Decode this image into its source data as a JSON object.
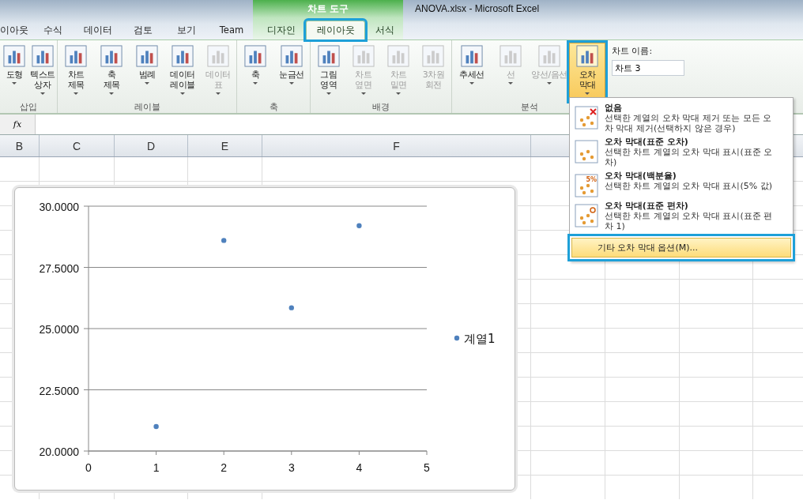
{
  "window": {
    "title": "ANOVA.xlsx  -  Microsoft Excel",
    "context_group": "차트 도구"
  },
  "tabs": [
    {
      "label": "이아웃",
      "selected": false,
      "contextual": false,
      "highlighted": false
    },
    {
      "label": "수식",
      "selected": false,
      "contextual": false,
      "highlighted": false
    },
    {
      "label": "데이터",
      "selected": false,
      "contextual": false,
      "highlighted": false
    },
    {
      "label": "검토",
      "selected": false,
      "contextual": false,
      "highlighted": false
    },
    {
      "label": "보기",
      "selected": false,
      "contextual": false,
      "highlighted": false
    },
    {
      "label": "Team",
      "selected": false,
      "contextual": false,
      "highlighted": false
    },
    {
      "label": "디자인",
      "selected": false,
      "contextual": true,
      "highlighted": false
    },
    {
      "label": "레이아웃",
      "selected": true,
      "contextual": true,
      "highlighted": true
    },
    {
      "label": "서식",
      "selected": false,
      "contextual": true,
      "highlighted": false
    }
  ],
  "ribbon": {
    "groups": [
      {
        "label": "삽입",
        "buttons": [
          {
            "lines": [
              "도형"
            ],
            "dropdown": true,
            "disabled": false,
            "highlighted": false
          },
          {
            "lines": [
              "텍스트",
              "상자"
            ],
            "dropdown": true,
            "disabled": false,
            "highlighted": false
          }
        ]
      },
      {
        "label": "레이블",
        "buttons": [
          {
            "lines": [
              "차트",
              "제목"
            ],
            "dropdown": true,
            "disabled": false,
            "highlighted": false
          },
          {
            "lines": [
              "축",
              "제목"
            ],
            "dropdown": true,
            "disabled": false,
            "highlighted": false
          },
          {
            "lines": [
              "범례"
            ],
            "dropdown": true,
            "disabled": false,
            "highlighted": false
          },
          {
            "lines": [
              "데이터",
              "레이블"
            ],
            "dropdown": true,
            "disabled": false,
            "highlighted": false
          },
          {
            "lines": [
              "데이터",
              "표"
            ],
            "dropdown": true,
            "disabled": true,
            "highlighted": false
          }
        ]
      },
      {
        "label": "축",
        "buttons": [
          {
            "lines": [
              "축"
            ],
            "dropdown": true,
            "disabled": false,
            "highlighted": false
          },
          {
            "lines": [
              "눈금선"
            ],
            "dropdown": true,
            "disabled": false,
            "highlighted": false
          }
        ]
      },
      {
        "label": "배경",
        "buttons": [
          {
            "lines": [
              "그림",
              "영역"
            ],
            "dropdown": true,
            "disabled": false,
            "highlighted": false
          },
          {
            "lines": [
              "차트",
              "옆면"
            ],
            "dropdown": true,
            "disabled": true,
            "highlighted": false
          },
          {
            "lines": [
              "차트",
              "밑면"
            ],
            "dropdown": true,
            "disabled": true,
            "highlighted": false
          },
          {
            "lines": [
              "3차원",
              "회전"
            ],
            "dropdown": false,
            "disabled": true,
            "highlighted": false
          }
        ]
      },
      {
        "label": "분석",
        "buttons": [
          {
            "lines": [
              "추세선"
            ],
            "dropdown": true,
            "disabled": false,
            "highlighted": false
          },
          {
            "lines": [
              "선"
            ],
            "dropdown": true,
            "disabled": true,
            "highlighted": false
          },
          {
            "lines": [
              "양선/음선"
            ],
            "dropdown": true,
            "disabled": true,
            "highlighted": false
          },
          {
            "lines": [
              "오차",
              "막대"
            ],
            "dropdown": true,
            "disabled": false,
            "highlighted": true
          }
        ]
      }
    ],
    "chart_name": {
      "label": "차트 이름:",
      "value": "차트 3"
    }
  },
  "formula_bar": {
    "fx": "fx"
  },
  "columns": [
    {
      "label": "B"
    },
    {
      "label": "C"
    },
    {
      "label": "D"
    },
    {
      "label": "E"
    },
    {
      "label": "F"
    }
  ],
  "chart": {
    "chart_data": {
      "type": "scatter",
      "x": [
        1,
        2,
        3,
        4
      ],
      "series": [
        {
          "name": "계열1",
          "color": "#4f81bd",
          "values": [
            21.0,
            28.6,
            25.85,
            29.2
          ]
        }
      ],
      "xlim": [
        0,
        5
      ],
      "ylim": [
        20,
        30
      ],
      "grid": true,
      "xticks": [
        0,
        1,
        2,
        3,
        4,
        5
      ],
      "yticks": [
        {
          "value": 20,
          "label": "20.0000"
        },
        {
          "value": 22.5,
          "label": "22.5000"
        },
        {
          "value": 25,
          "label": "25.0000"
        },
        {
          "value": 27.5,
          "label": "27.5000"
        },
        {
          "value": 30,
          "label": "30.0000"
        }
      ]
    }
  },
  "menu": {
    "items": [
      {
        "kind": "none",
        "title": "없음",
        "description": "선택한 계열의 오차 막대 제거 또는 모든 오차 막대 제거(선택하지 않은 경우)"
      },
      {
        "kind": "standard-error",
        "title": "오차 막대(표준 오차)",
        "description": "선택한 차트 계열의 오차 막대 표시(표준 오차)"
      },
      {
        "kind": "percent",
        "badge": "5%",
        "title": "오차 막대(백분율)",
        "description": "선택한 차트 계열의 오차 막대 표시(5% 값)"
      },
      {
        "kind": "std-dev",
        "title": "오차 막대(표준 편차)",
        "description": "선택한 차트 계열의 오차 막대 표시(표준 편차 1)"
      }
    ],
    "more": {
      "label": "기타 오차 막대 옵션(M)...",
      "highlighted": true
    }
  }
}
